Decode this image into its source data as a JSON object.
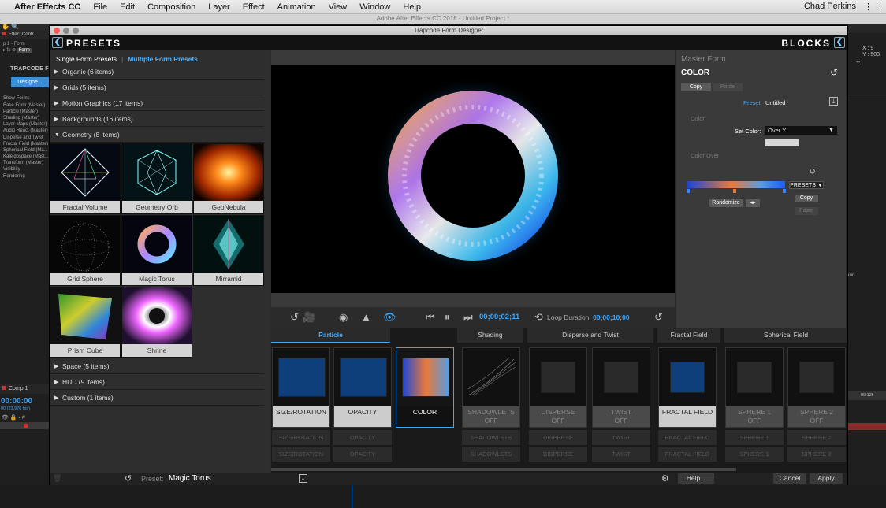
{
  "mac_menubar": {
    "app": "After Effects CC",
    "menus": [
      "File",
      "Edit",
      "Composition",
      "Layer",
      "Effect",
      "Animation",
      "View",
      "Window",
      "Help"
    ],
    "user": "Chad Perkins"
  },
  "ae_window_title": "Adobe After Effects CC 2018 - Untitled Project *",
  "ae_left": {
    "tab": "Effect Contr...",
    "layer": "p 1 - Form",
    "comp": "Form",
    "brand": "TRAPCODE FO...",
    "designer_btn": "Designe...",
    "tree": [
      "Show Forms",
      "Base Form (Master)",
      "Particle (Master)",
      "Shading (Master)",
      "Layer Maps (Master)",
      "Audio React (Master)",
      "Disperse and Twist",
      "Fractal Field (Master)",
      "Spherical Field (Ma...",
      "Kaleidospace (Mast...",
      "Transform (Master)",
      "Visibility",
      "Rendering"
    ],
    "comp_tab": "Comp 1",
    "timecode": "00:00:00",
    "fps": "00 (23.976 fps)"
  },
  "ae_right": {
    "coords": "X : 9\nY : 503",
    "ion": "ion",
    "tc": "09:12f"
  },
  "dialog": {
    "title": "Trapcode Form Designer",
    "presets_header": "PRESETS",
    "blocks_header": "BLOCKS",
    "preset_tabs": {
      "single": "Single Form Presets",
      "multiple": "Multiple Form Presets"
    },
    "categories_top": [
      {
        "name": "Organic (6 items)"
      },
      {
        "name": "Grids (5 items)"
      },
      {
        "name": "Motion Graphics (17 items)"
      },
      {
        "name": "Backgrounds (16 items)"
      }
    ],
    "open_category": "Geometry (8 items)",
    "thumbnails": [
      "Fractal Volume",
      "Geometry Orb",
      "GeoNebula",
      "Grid Sphere",
      "Magic Torus",
      "Mirramid",
      "Prism Cube",
      "Shrine"
    ],
    "categories_bottom": [
      {
        "name": "Space (5 items)"
      },
      {
        "name": "HUD (9 items)"
      },
      {
        "name": "Custom (1 items)"
      }
    ],
    "transport": {
      "timecode": "00;00;02;11",
      "loop_label": "Loop Duration:",
      "loop_value": "00;00;10;00"
    },
    "right_panel": {
      "master": "Master Form",
      "section": "COLOR",
      "copy": "Copy",
      "paste": "Paste",
      "preset_label": "Preset:",
      "preset_value": "Untitled",
      "color_label": "Color",
      "set_color_label": "Set Color:",
      "set_color_value": "Over Y",
      "color_over_label": "Color Over",
      "presets_btn": "PRESETS",
      "copy2": "Copy",
      "paste2": "Paste",
      "randomize": "Randomize"
    },
    "block_groups": [
      "Particle",
      "Shading",
      "Disperse and Twist",
      "Fractal Field",
      "Spherical Field"
    ],
    "blocks": [
      {
        "line1": "SIZE/ROTATION",
        "line2": ""
      },
      {
        "line1": "OPACITY",
        "line2": ""
      },
      {
        "line1": "COLOR",
        "line2": ""
      },
      {
        "line1": "SHADOWLETS",
        "line2": "OFF"
      },
      {
        "line1": "DISPERSE",
        "line2": "OFF"
      },
      {
        "line1": "TWIST",
        "line2": "OFF"
      },
      {
        "line1": "FRACTAL FIELD",
        "line2": ""
      },
      {
        "line1": "SPHERE 1",
        "line2": "OFF"
      },
      {
        "line1": "SPHERE 2",
        "line2": "OFF"
      }
    ],
    "sub_blocks": {
      "b0": [
        "SIZE/ROTATION",
        "SIZE/ROTATION"
      ],
      "b1": [
        "OPACITY",
        "OPACITY"
      ],
      "b3": [
        "SHADOWLETS",
        "SHADOWLETS"
      ],
      "b4": [
        "DISPERSE",
        "DISPERSE"
      ],
      "b5": [
        "TWIST",
        "TWIST"
      ],
      "b6": [
        "FRACTAL FIELD",
        "FRACTAL FIELD"
      ],
      "b7": [
        "SPHERE 1",
        "SPHERE 1"
      ],
      "b8": [
        "SPHERE 2",
        "SPHERE 2"
      ]
    },
    "footer": {
      "preset_label": "Preset:",
      "preset_value": "Magic Torus",
      "help": "Help...",
      "cancel": "Cancel",
      "apply": "Apply"
    }
  }
}
